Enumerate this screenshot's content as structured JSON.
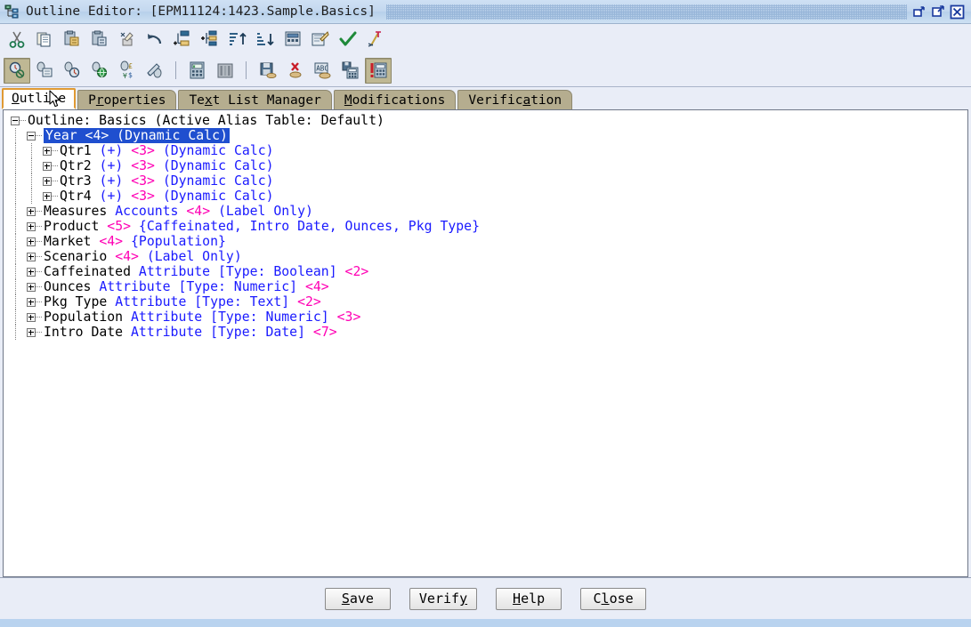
{
  "window": {
    "title": "Outline Editor: [EPM11124:1423.Sample.Basics]",
    "icon": "outline-tree-icon",
    "controls": [
      {
        "name": "restore-button",
        "glyph": "restore"
      },
      {
        "name": "maximize-button",
        "glyph": "maximize"
      },
      {
        "name": "close-button",
        "glyph": "close"
      }
    ]
  },
  "toolbar_row1": [
    {
      "name": "cut-button",
      "icon": "scissors-icon",
      "title": "Cut"
    },
    {
      "name": "copy-button",
      "icon": "copy-icon",
      "title": "Copy"
    },
    {
      "name": "paste-button",
      "icon": "paste-icon",
      "title": "Paste"
    },
    {
      "name": "paste-special-button",
      "icon": "paste-special-icon",
      "title": "Paste Special"
    },
    {
      "name": "delete-button",
      "icon": "erase-icon",
      "title": "Delete"
    },
    {
      "name": "undo-button",
      "icon": "undo-arrow-icon",
      "title": "Undo"
    },
    {
      "name": "add-child-button",
      "icon": "add-child-icon",
      "title": "Add Child"
    },
    {
      "name": "add-sibling-button",
      "icon": "add-sibling-icon",
      "title": "Add Sibling"
    },
    {
      "name": "sort-ascending-button",
      "icon": "sort-asc-icon",
      "title": "Sort Ascending"
    },
    {
      "name": "sort-descending-button",
      "icon": "sort-desc-icon",
      "title": "Sort Descending"
    },
    {
      "name": "outline-properties-button",
      "icon": "outline-props-icon",
      "title": "Outline Properties"
    },
    {
      "name": "member-properties-button",
      "icon": "member-props-icon",
      "title": "Member Properties"
    },
    {
      "name": "verify-outline-button",
      "icon": "checkmark-icon",
      "title": "Verify Outline"
    },
    {
      "name": "clear-button",
      "icon": "clear-broom-icon",
      "title": "Clear"
    }
  ],
  "toolbar_row2": [
    {
      "name": "find-member-button",
      "icon": "find-disabled-icon",
      "title": "Find Member",
      "state": "pressed"
    },
    {
      "name": "zoom-next-button",
      "icon": "member-page-icon",
      "title": "Next"
    },
    {
      "name": "zoom-prev-button",
      "icon": "member-clock-icon",
      "title": "Previous"
    },
    {
      "name": "attach-member-button",
      "icon": "member-globe-icon",
      "title": "Attach"
    },
    {
      "name": "currency-member-button",
      "icon": "member-currency-icon",
      "title": "Currency"
    },
    {
      "name": "alias-button",
      "icon": "member-edit-icon",
      "title": "Alias"
    },
    {
      "name": "separator-1",
      "icon": "separator",
      "title": ""
    },
    {
      "name": "calc-script-button",
      "icon": "calc-green-icon",
      "title": "Calc Script"
    },
    {
      "name": "dimension-build-button",
      "icon": "dimension-bars-icon",
      "title": "Dimension Build"
    },
    {
      "name": "separator-2",
      "icon": "separator",
      "title": ""
    },
    {
      "name": "save-outline-button",
      "icon": "save-floppy-icon",
      "title": "Save Outline"
    },
    {
      "name": "delete-outline-button",
      "icon": "delete-red-x-icon",
      "title": "Delete"
    },
    {
      "name": "spellcheck-button",
      "icon": "abc-spellcheck-icon",
      "title": "Spell Check"
    },
    {
      "name": "save-calc-button",
      "icon": "save-calc-icon",
      "title": "Save As"
    },
    {
      "name": "verify-calc-button",
      "icon": "verify-alert-calc-icon",
      "title": "Verify",
      "state": "pressed"
    }
  ],
  "tabs": [
    {
      "name": "tab-outline",
      "label": "Outline",
      "mnemonic_index": 0,
      "active": true
    },
    {
      "name": "tab-properties",
      "label": "Properties",
      "mnemonic_index": 1,
      "active": false
    },
    {
      "name": "tab-text-list-manager",
      "label": "Text List Manager",
      "mnemonic_index": 2,
      "active": false
    },
    {
      "name": "tab-modifications",
      "label": "Modifications",
      "mnemonic_index": 0,
      "active": false
    },
    {
      "name": "tab-verification",
      "label": "Verification",
      "mnemonic_index": 7,
      "active": false
    }
  ],
  "outline": {
    "rows": [
      {
        "name": "outline-root",
        "depth": 0,
        "toggle": "minus",
        "selected": false,
        "parts": [
          {
            "text": "Outline: Basics (Active Alias Table: Default)",
            "color": "black"
          }
        ]
      },
      {
        "name": "tree-node-year",
        "depth": 1,
        "toggle": "minus",
        "selected": true,
        "parts": [
          {
            "text": "Year <4> (Dynamic Calc)",
            "color": "white"
          }
        ]
      },
      {
        "name": "tree-node-qtr1",
        "depth": 2,
        "toggle": "plus",
        "selected": false,
        "parts": [
          {
            "text": "Qtr1 ",
            "color": "black"
          },
          {
            "text": "(+) ",
            "color": "blue"
          },
          {
            "text": "<3> ",
            "color": "pink"
          },
          {
            "text": "(Dynamic Calc)",
            "color": "blue"
          }
        ]
      },
      {
        "name": "tree-node-qtr2",
        "depth": 2,
        "toggle": "plus",
        "selected": false,
        "parts": [
          {
            "text": "Qtr2 ",
            "color": "black"
          },
          {
            "text": "(+) ",
            "color": "blue"
          },
          {
            "text": "<3> ",
            "color": "pink"
          },
          {
            "text": "(Dynamic Calc)",
            "color": "blue"
          }
        ]
      },
      {
        "name": "tree-node-qtr3",
        "depth": 2,
        "toggle": "plus",
        "selected": false,
        "parts": [
          {
            "text": "Qtr3 ",
            "color": "black"
          },
          {
            "text": "(+) ",
            "color": "blue"
          },
          {
            "text": "<3> ",
            "color": "pink"
          },
          {
            "text": "(Dynamic Calc)",
            "color": "blue"
          }
        ]
      },
      {
        "name": "tree-node-qtr4",
        "depth": 2,
        "toggle": "plus",
        "selected": false,
        "parts": [
          {
            "text": "Qtr4 ",
            "color": "black"
          },
          {
            "text": "(+) ",
            "color": "blue"
          },
          {
            "text": "<3> ",
            "color": "pink"
          },
          {
            "text": "(Dynamic Calc)",
            "color": "blue"
          }
        ]
      },
      {
        "name": "tree-node-measures",
        "depth": 1,
        "toggle": "plus",
        "selected": false,
        "parts": [
          {
            "text": "Measures ",
            "color": "black"
          },
          {
            "text": "Accounts ",
            "color": "blue"
          },
          {
            "text": "<4> ",
            "color": "pink"
          },
          {
            "text": "(Label Only)",
            "color": "blue"
          }
        ]
      },
      {
        "name": "tree-node-product",
        "depth": 1,
        "toggle": "plus",
        "selected": false,
        "parts": [
          {
            "text": "Product ",
            "color": "black"
          },
          {
            "text": "<5> ",
            "color": "pink"
          },
          {
            "text": "{Caffeinated, Intro Date, Ounces, Pkg Type}",
            "color": "blue"
          }
        ]
      },
      {
        "name": "tree-node-market",
        "depth": 1,
        "toggle": "plus",
        "selected": false,
        "parts": [
          {
            "text": "Market ",
            "color": "black"
          },
          {
            "text": "<4> ",
            "color": "pink"
          },
          {
            "text": "{Population}",
            "color": "blue"
          }
        ]
      },
      {
        "name": "tree-node-scenario",
        "depth": 1,
        "toggle": "plus",
        "selected": false,
        "parts": [
          {
            "text": "Scenario ",
            "color": "black"
          },
          {
            "text": "<4> ",
            "color": "pink"
          },
          {
            "text": "(Label Only)",
            "color": "blue"
          }
        ]
      },
      {
        "name": "tree-node-caffeinated",
        "depth": 1,
        "toggle": "plus",
        "selected": false,
        "parts": [
          {
            "text": "Caffeinated ",
            "color": "black"
          },
          {
            "text": "Attribute [Type: Boolean] ",
            "color": "blue"
          },
          {
            "text": "<2>",
            "color": "pink"
          }
        ]
      },
      {
        "name": "tree-node-ounces",
        "depth": 1,
        "toggle": "plus",
        "selected": false,
        "parts": [
          {
            "text": "Ounces ",
            "color": "black"
          },
          {
            "text": "Attribute [Type: Numeric] ",
            "color": "blue"
          },
          {
            "text": "<4>",
            "color": "pink"
          }
        ]
      },
      {
        "name": "tree-node-pkg-type",
        "depth": 1,
        "toggle": "plus",
        "selected": false,
        "parts": [
          {
            "text": "Pkg Type ",
            "color": "black"
          },
          {
            "text": "Attribute [Type: Text] ",
            "color": "blue"
          },
          {
            "text": "<2>",
            "color": "pink"
          }
        ]
      },
      {
        "name": "tree-node-population",
        "depth": 1,
        "toggle": "plus",
        "selected": false,
        "parts": [
          {
            "text": "Population ",
            "color": "black"
          },
          {
            "text": "Attribute [Type: Numeric] ",
            "color": "blue"
          },
          {
            "text": "<3>",
            "color": "pink"
          }
        ]
      },
      {
        "name": "tree-node-intro-date",
        "depth": 1,
        "toggle": "plus",
        "selected": false,
        "parts": [
          {
            "text": "Intro Date ",
            "color": "black"
          },
          {
            "text": "Attribute [Type: Date] ",
            "color": "blue"
          },
          {
            "text": "<7>",
            "color": "pink"
          }
        ]
      }
    ]
  },
  "footer": {
    "buttons": [
      {
        "name": "save-button",
        "label": "Save",
        "mnemonic_index": 0
      },
      {
        "name": "verify-button",
        "label": "Verify",
        "mnemonic_index": 5
      },
      {
        "name": "help-button",
        "label": "Help",
        "mnemonic_index": 0
      },
      {
        "name": "close-button",
        "label": "Close",
        "mnemonic_index": 1
      }
    ]
  },
  "colors": {
    "selection_blue": "#1f4fcf",
    "member_blue": "#1a1aff",
    "count_pink": "#ff00b4",
    "tab_inactive": "#b5ad8f",
    "tab_active_border": "#e09a33",
    "toolbar_bg": "#e9edf7",
    "titlebar_bg": "#c3d8ef"
  }
}
